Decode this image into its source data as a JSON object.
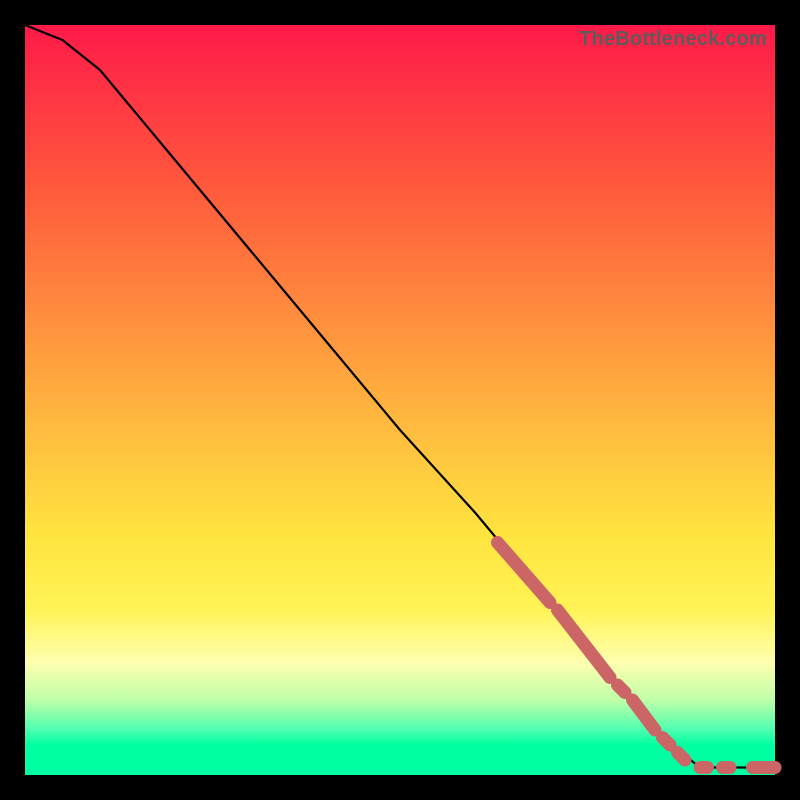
{
  "watermark": "TheBottleneck.com",
  "chart_data": {
    "type": "line",
    "title": "",
    "xlabel": "",
    "ylabel": "",
    "xlim": [
      0,
      100
    ],
    "ylim": [
      0,
      100
    ],
    "grid": false,
    "line": {
      "x": [
        0,
        5,
        10,
        20,
        30,
        40,
        50,
        60,
        70,
        80,
        85,
        90,
        95,
        100
      ],
      "y": [
        100,
        98,
        94,
        82,
        70,
        58,
        46,
        35,
        23,
        11,
        5,
        1,
        1,
        1
      ]
    },
    "marker_color": "#cc6666",
    "marker_segments": [
      {
        "x0": 63,
        "y0": 31,
        "x1": 70,
        "y1": 23
      },
      {
        "x0": 71,
        "y0": 22,
        "x1": 78,
        "y1": 13
      },
      {
        "x0": 79,
        "y0": 12,
        "x1": 80,
        "y1": 11
      },
      {
        "x0": 81,
        "y0": 10,
        "x1": 84,
        "y1": 6
      },
      {
        "x0": 85,
        "y0": 5,
        "x1": 86,
        "y1": 4
      },
      {
        "x0": 87,
        "y0": 3,
        "x1": 88,
        "y1": 2
      },
      {
        "x0": 90,
        "y0": 1,
        "x1": 91,
        "y1": 1
      },
      {
        "x0": 93,
        "y0": 1,
        "x1": 94,
        "y1": 1
      },
      {
        "x0": 97,
        "y0": 1,
        "x1": 100,
        "y1": 1
      }
    ]
  }
}
